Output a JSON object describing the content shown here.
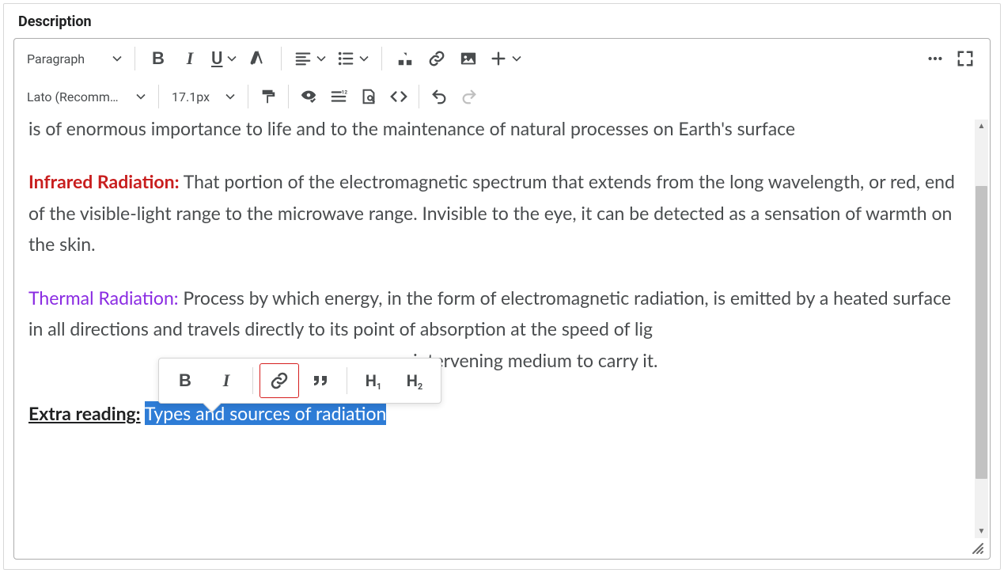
{
  "panel": {
    "label": "Description"
  },
  "toolbar": {
    "paragraph_style": "Paragraph",
    "font_family": "Lato (Recomm…",
    "font_size": "17.1px"
  },
  "content": {
    "p0_a": "and radio emissions, as well as visible light, emanating from the Sun. The small part of this energy intercepted by Earth is of enormous importance to life and to the maintenance of natural processes on Earth's surface",
    "p1_head": "Infrared Radiation:",
    "p1_body": " That portion of the electromagnetic spectrum that extends from the long wavelength, or red, end of the visible-light range to the microwave range. Invisible to the eye, it can be detected as a sensation of warmth on the skin.",
    "p2_head": "Thermal Radiation:",
    "p2_body_1": " Process by which energy, in the form of electromagnetic radiation, is emitted by a heated surface in all directions and travels directly to its point of absorption at the speed of lig",
    "p2_body_2": "re an intervening medium to carry it.",
    "extra_label": "Extra reading:",
    "extra_link_text": "Types and sources of radiation"
  },
  "floating": {
    "h1": "H",
    "h1_sub": "1",
    "h2": "H",
    "h2_sub": "2"
  }
}
